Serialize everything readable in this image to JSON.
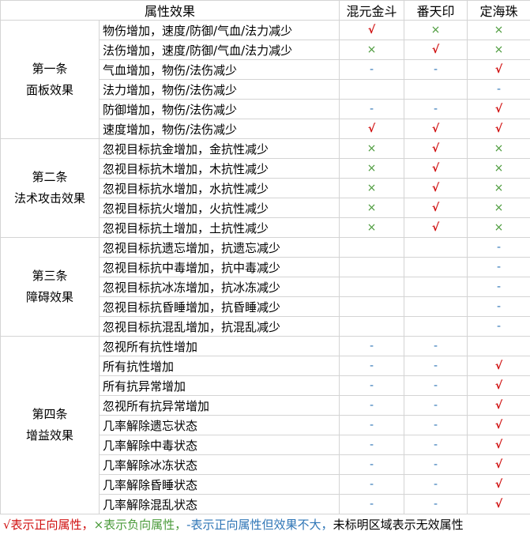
{
  "header": {
    "attr": "属性效果",
    "col1": "混元金斗",
    "col2": "番天印",
    "col3": "定海珠"
  },
  "sections": [
    {
      "label_line1": "第一条",
      "label_line2": "面板效果",
      "rows": [
        {
          "attr": "物伤增加，速度/防御/气血/法力减少",
          "c1": "√",
          "c2": "×",
          "c3": "×"
        },
        {
          "attr": "法伤增加，速度/防御/气血/法力减少",
          "c1": "×",
          "c2": "√",
          "c3": "×"
        },
        {
          "attr": "气血增加，物伤/法伤减少",
          "c1": "-",
          "c2": "-",
          "c3": "√"
        },
        {
          "attr": "法力增加，物伤/法伤减少",
          "c1": "",
          "c2": "",
          "c3": "-"
        },
        {
          "attr": "防御增加，物伤/法伤减少",
          "c1": "-",
          "c2": "-",
          "c3": "√"
        },
        {
          "attr": "速度增加，物伤/法伤减少",
          "c1": "√",
          "c2": "√",
          "c3": "√"
        }
      ]
    },
    {
      "label_line1": "第二条",
      "label_line2": "法术攻击效果",
      "rows": [
        {
          "attr": "忽视目标抗金增加，金抗性减少",
          "c1": "×",
          "c2": "√",
          "c3": "×"
        },
        {
          "attr": "忽视目标抗木增加，木抗性减少",
          "c1": "×",
          "c2": "√",
          "c3": "×"
        },
        {
          "attr": "忽视目标抗水增加，水抗性减少",
          "c1": "×",
          "c2": "√",
          "c3": "×"
        },
        {
          "attr": "忽视目标抗火增加，火抗性减少",
          "c1": "×",
          "c2": "√",
          "c3": "×"
        },
        {
          "attr": "忽视目标抗土增加，土抗性减少",
          "c1": "×",
          "c2": "√",
          "c3": "×"
        }
      ]
    },
    {
      "label_line1": "第三条",
      "label_line2": "障碍效果",
      "rows": [
        {
          "attr": "忽视目标抗遗忘增加，抗遗忘减少",
          "c1": "",
          "c2": "",
          "c3": "-"
        },
        {
          "attr": "忽视目标抗中毒增加，抗中毒减少",
          "c1": "",
          "c2": "",
          "c3": "-"
        },
        {
          "attr": "忽视目标抗冰冻增加，抗冰冻减少",
          "c1": "",
          "c2": "",
          "c3": "-"
        },
        {
          "attr": "忽视目标抗昏睡增加，抗昏睡减少",
          "c1": "",
          "c2": "",
          "c3": "-"
        },
        {
          "attr": "忽视目标抗混乱增加，抗混乱减少",
          "c1": "",
          "c2": "",
          "c3": "-"
        }
      ]
    },
    {
      "label_line1": "第四条",
      "label_line2": "增益效果",
      "rows": [
        {
          "attr": "忽视所有抗性增加",
          "c1": "-",
          "c2": "-",
          "c3": ""
        },
        {
          "attr": "所有抗性增加",
          "c1": "-",
          "c2": "-",
          "c3": "√"
        },
        {
          "attr": "所有抗异常增加",
          "c1": "-",
          "c2": "-",
          "c3": "√"
        },
        {
          "attr": "忽视所有抗异常增加",
          "c1": "-",
          "c2": "-",
          "c3": "√"
        },
        {
          "attr": "几率解除遗忘状态",
          "c1": "-",
          "c2": "-",
          "c3": "√"
        },
        {
          "attr": "几率解除中毒状态",
          "c1": "-",
          "c2": "-",
          "c3": "√"
        },
        {
          "attr": "几率解除冰冻状态",
          "c1": "-",
          "c2": "-",
          "c3": "√"
        },
        {
          "attr": "几率解除昏睡状态",
          "c1": "-",
          "c2": "-",
          "c3": "√"
        },
        {
          "attr": "几率解除混乱状态",
          "c1": "-",
          "c2": "-",
          "c3": "√"
        }
      ]
    }
  ],
  "legend": {
    "pos": "√表示正向属性，",
    "neg": "×表示负向属性，",
    "weak": "-表示正向属性但效果不大，",
    "none": "未标明区域表示无效属性"
  },
  "colors": {
    "positive": "#d01010",
    "negative": "#4a9a3a",
    "weak": "#2e75b6",
    "grid": "#d4d4d4"
  }
}
